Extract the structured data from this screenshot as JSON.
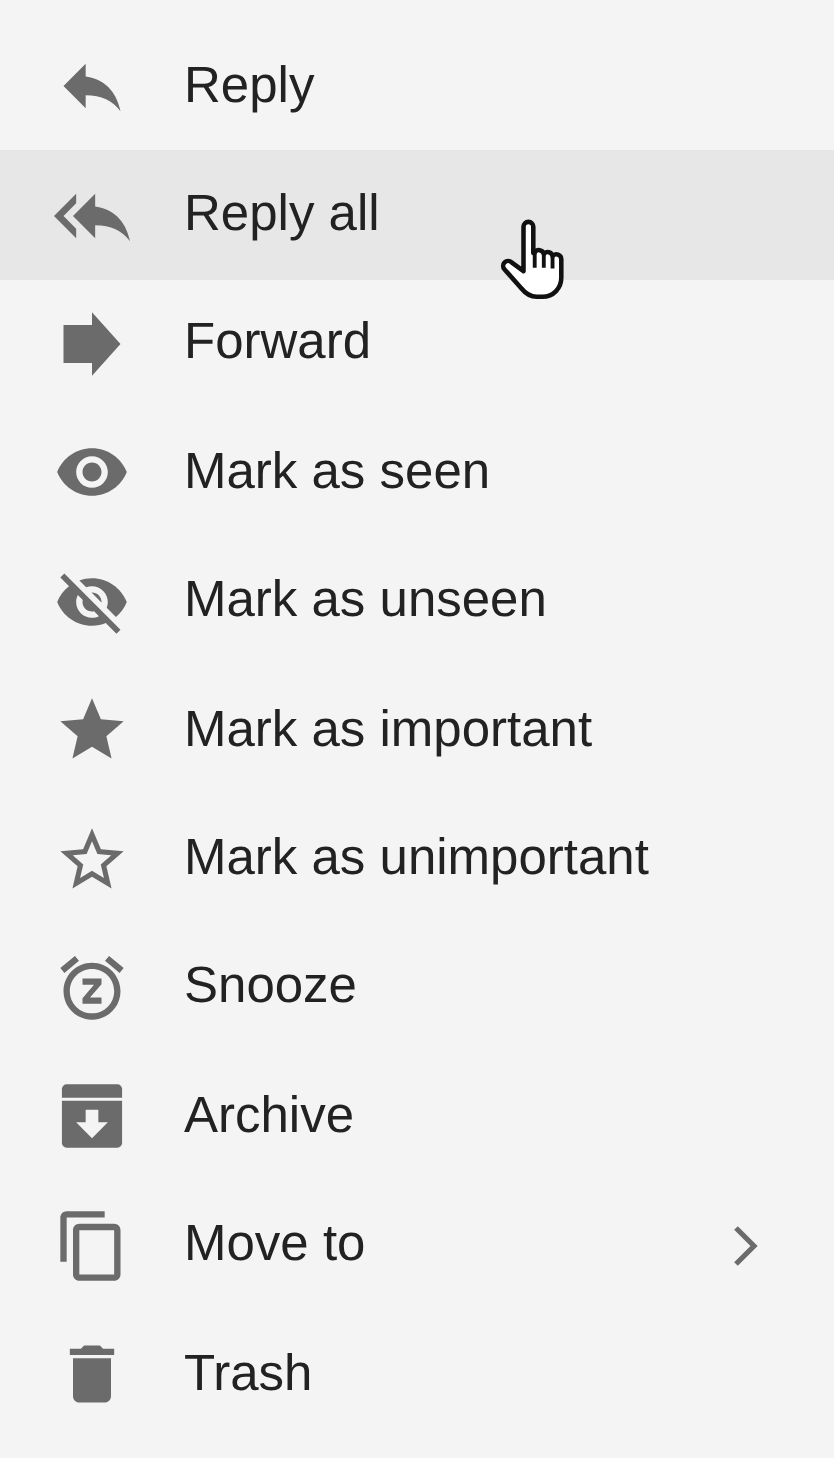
{
  "menu": {
    "items": [
      {
        "label": "Reply",
        "kind": "reply",
        "selected": false,
        "submenu": false
      },
      {
        "label": "Reply all",
        "kind": "reply_all",
        "selected": true,
        "submenu": false
      },
      {
        "label": "Forward",
        "kind": "forward",
        "selected": false,
        "submenu": false
      },
      {
        "label": "Mark as seen",
        "kind": "seen",
        "selected": false,
        "submenu": false
      },
      {
        "label": "Mark as unseen",
        "kind": "unseen",
        "selected": false,
        "submenu": false
      },
      {
        "label": "Mark as important",
        "kind": "star",
        "selected": false,
        "submenu": false
      },
      {
        "label": "Mark as unimportant",
        "kind": "star_border",
        "selected": false,
        "submenu": false
      },
      {
        "label": "Snooze",
        "kind": "snooze",
        "selected": false,
        "submenu": false
      },
      {
        "label": "Archive",
        "kind": "archive",
        "selected": false,
        "submenu": false
      },
      {
        "label": "Move to",
        "kind": "move",
        "selected": false,
        "submenu": true
      },
      {
        "label": "Trash",
        "kind": "trash",
        "selected": false,
        "submenu": false
      }
    ]
  }
}
